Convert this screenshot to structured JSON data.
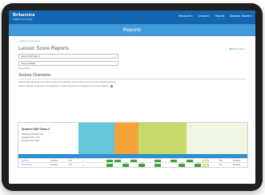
{
  "brand": {
    "name": "Britannica",
    "sub": "Digital Learning"
  },
  "nav": [
    "Resources ▾",
    "Lessons ▾",
    "Reports",
    "Assessor Teacher ▾"
  ],
  "page_title": "Reports",
  "back_link": "« Return to previous",
  "lesson_reports_title": "Lesson Score Reports",
  "print_link": "Print report",
  "selects": {
    "class": "Susan's 6AP Class 2",
    "unit": "Animal Habitats"
  },
  "view_link": "View details ›",
  "score_overview": {
    "title": "Scores Overview",
    "description": "Students data will appear once answers have been submitted. Click a student's name to review individual answers.",
    "note": "Answer checking not allowed for this assignment. Students cannot see a breakdown until they are finished."
  },
  "table": {
    "class_name": "Susan's 6AP Class 2",
    "stats": [
      {
        "label": "Students Submitted:",
        "value": "2/2"
      },
      {
        "label": "Average Score:",
        "value": "71%"
      },
      {
        "label": "Average Time:",
        "value": "0:20"
      }
    ],
    "rows": [
      {
        "name": "Lightfoot",
        "status": "Finished",
        "score": "71%",
        "time": "—",
        "right": "71%"
      },
      {
        "name": "Brownbottle",
        "status": "Finished",
        "score": "71%",
        "time": "—",
        "right": "71%"
      }
    ]
  }
}
